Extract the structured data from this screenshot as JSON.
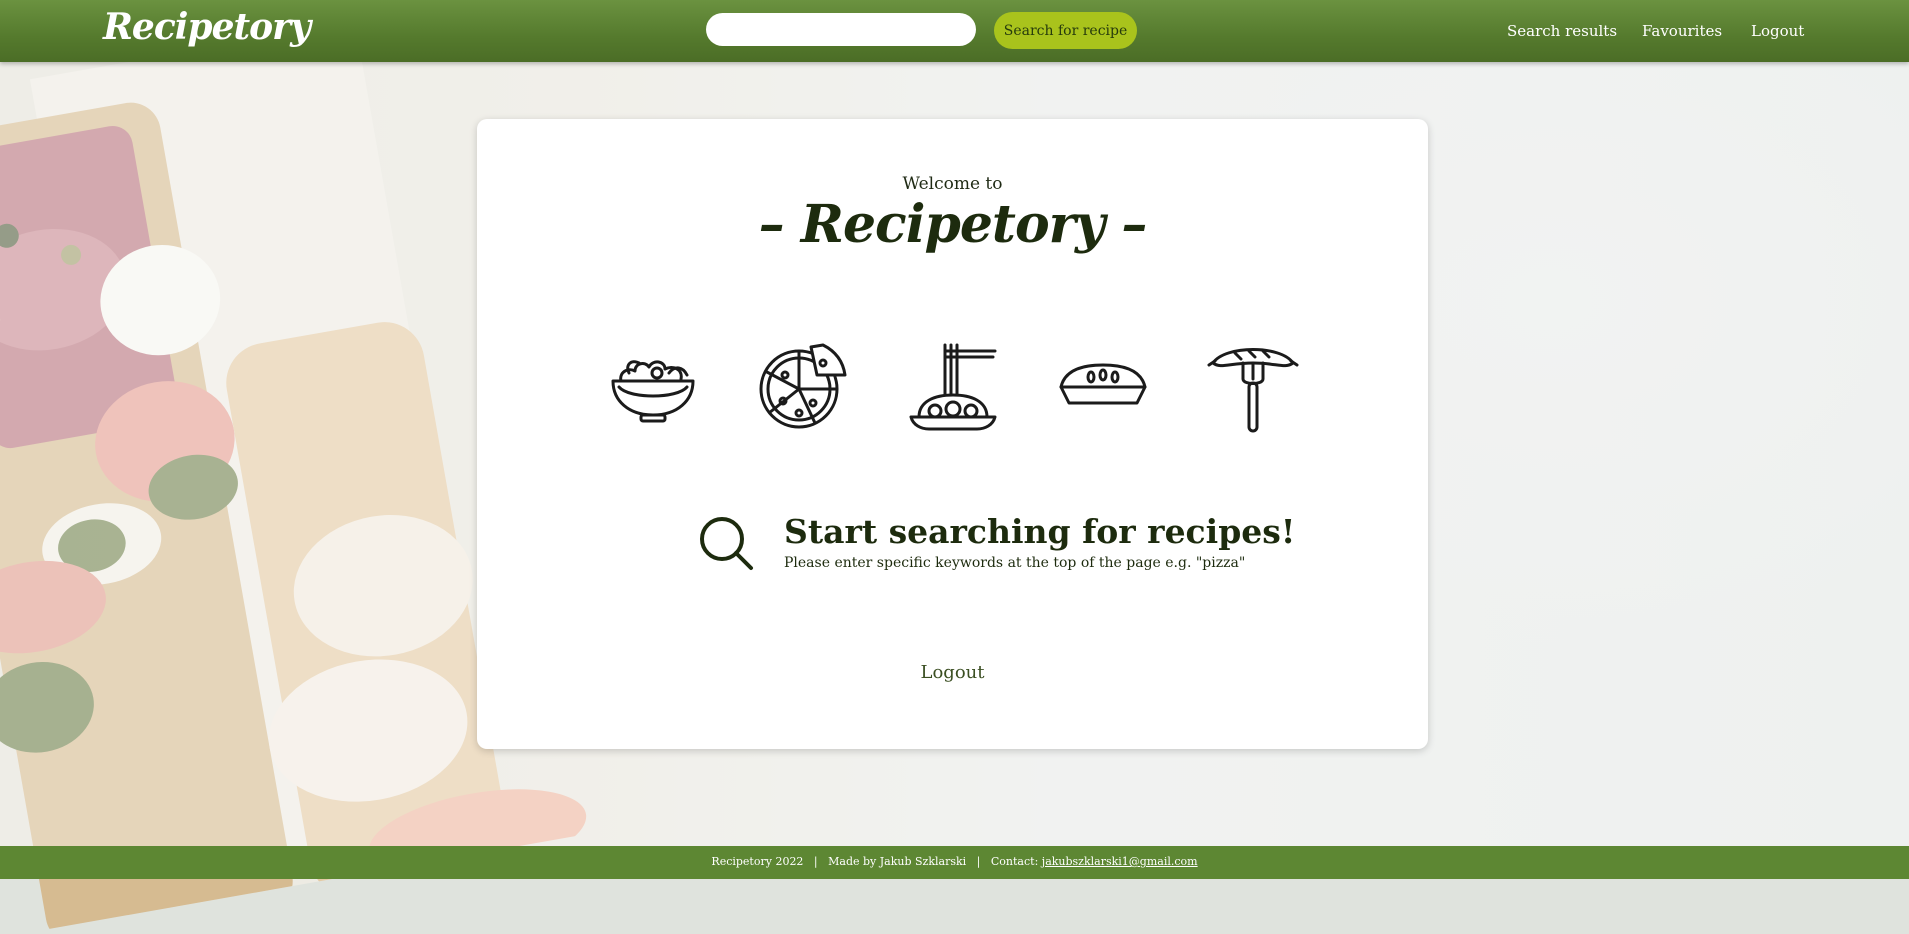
{
  "header": {
    "logo": "Recipetory",
    "search": {
      "value": "",
      "placeholder": ""
    },
    "search_button": "Search for recipe",
    "nav": [
      "Search results",
      "Favourites",
      "Logout"
    ]
  },
  "main": {
    "welcome": "Welcome to",
    "brand": "– Recipetory –",
    "food_icons": [
      "salad-bowl-icon",
      "pizza-icon",
      "spaghetti-icon",
      "pie-icon",
      "sausage-on-fork-icon"
    ],
    "hint_title": "Start searching for recipes!",
    "hint_sub": "Please enter specific keywords at the top of the page e.g. \"pizza\"",
    "logout": "Logout"
  },
  "footer": {
    "copyright": "Recipetory 2022",
    "made_by": "Made by Jakub Szklarski",
    "contact_label": "Contact:",
    "contact_email": "jakubszklarski1@gmail.com"
  },
  "colors": {
    "header": "#557a2d",
    "accent_button": "#a9c31c",
    "text_dark": "#1d2b0e",
    "footer": "#5d8733"
  }
}
